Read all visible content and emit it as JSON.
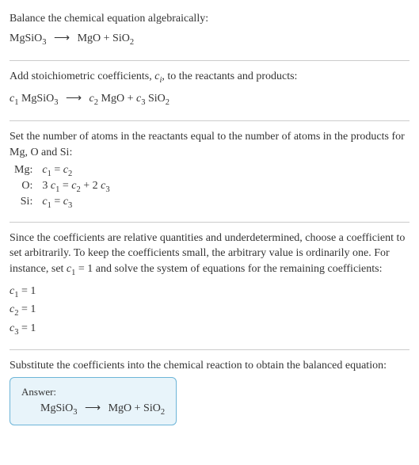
{
  "section1": {
    "instruction": "Balance the chemical equation algebraically:",
    "eq_left": "MgSiO",
    "eq_left_sub": "3",
    "arrow": "⟶",
    "eq_r1": "MgO",
    "plus": " + ",
    "eq_r2": "SiO",
    "eq_r2_sub": "2"
  },
  "section2": {
    "instruction_a": "Add stoichiometric coefficients, ",
    "ci": "c",
    "ci_sub": "i",
    "instruction_b": ", to the reactants and products:",
    "c1": "c",
    "c1_sub": "1",
    "sp1": " MgSiO",
    "sp1_sub": "3",
    "arrow": "⟶",
    "c2": "c",
    "c2_sub": "2",
    "sp2": " MgO",
    "plus": " + ",
    "c3": "c",
    "c3_sub": "3",
    "sp3": " SiO",
    "sp3_sub": "2"
  },
  "section3": {
    "instruction": "Set the number of atoms in the reactants equal to the number of atoms in the products for Mg, O and Si:",
    "rows": [
      {
        "el": "Mg:",
        "pre": "",
        "c_a": "c",
        "sub_a": "1",
        "mid": " = ",
        "c_b": "c",
        "sub_b": "2",
        "suf": ""
      },
      {
        "el": "O:",
        "pre": "3 ",
        "c_a": "c",
        "sub_a": "1",
        "mid": " = ",
        "c_b": "c",
        "sub_b": "2",
        "mid2": " + 2 ",
        "c_c": "c",
        "sub_c": "3"
      },
      {
        "el": "Si:",
        "pre": "",
        "c_a": "c",
        "sub_a": "1",
        "mid": " = ",
        "c_b": "c",
        "sub_b": "3",
        "suf": ""
      }
    ]
  },
  "section4": {
    "instruction_a": "Since the coefficients are relative quantities and underdetermined, choose a coefficient to set arbitrarily. To keep the coefficients small, the arbitrary value is ordinarily one. For instance, set ",
    "c1": "c",
    "c1_sub": "1",
    "instruction_b": " = 1 and solve the system of equations for the remaining coefficients:",
    "coeffs": [
      {
        "c": "c",
        "sub": "1",
        "val": " = 1"
      },
      {
        "c": "c",
        "sub": "2",
        "val": " = 1"
      },
      {
        "c": "c",
        "sub": "3",
        "val": " = 1"
      }
    ]
  },
  "section5": {
    "instruction": "Substitute the coefficients into the chemical reaction to obtain the balanced equation:",
    "answer_label": "Answer:",
    "eq_left": "MgSiO",
    "eq_left_sub": "3",
    "arrow": "⟶",
    "eq_r1": "MgO",
    "plus": " + ",
    "eq_r2": "SiO",
    "eq_r2_sub": "2"
  }
}
